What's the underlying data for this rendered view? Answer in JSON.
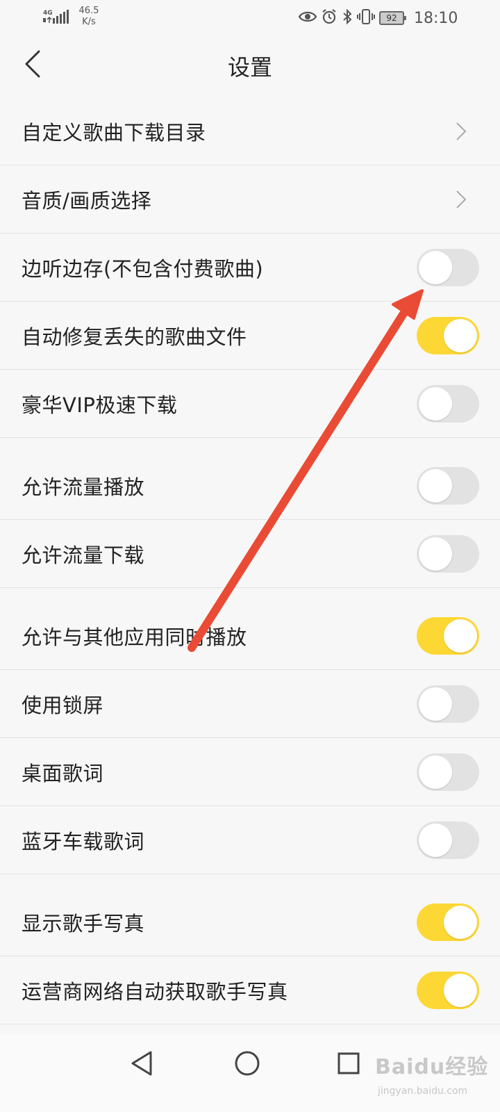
{
  "status_bar": {
    "network": "4G",
    "speed_value": "46.5",
    "speed_unit": "K/s",
    "battery": "92",
    "time": "18:10"
  },
  "header": {
    "title": "设置"
  },
  "settings": [
    {
      "label": "自定义歌曲下载目录",
      "control": "chevron"
    },
    {
      "label": "音质/画质选择",
      "control": "chevron"
    },
    {
      "label": "边听边存(不包含付费歌曲)",
      "control": "toggle",
      "on": false
    },
    {
      "label": "自动修复丢失的歌曲文件",
      "control": "toggle",
      "on": true
    },
    {
      "label": "豪华VIP极速下载",
      "control": "toggle",
      "on": false
    },
    {
      "label": "允许流量播放",
      "control": "toggle",
      "on": false
    },
    {
      "label": "允许流量下载",
      "control": "toggle",
      "on": false
    },
    {
      "label": "允许与其他应用同时播放",
      "control": "toggle",
      "on": true
    },
    {
      "label": "使用锁屏",
      "control": "toggle",
      "on": false
    },
    {
      "label": "桌面歌词",
      "control": "toggle",
      "on": false
    },
    {
      "label": "蓝牙车载歌词",
      "control": "toggle",
      "on": false
    },
    {
      "label": "显示歌手写真",
      "control": "toggle",
      "on": true
    },
    {
      "label": "运营商网络自动获取歌手写真",
      "control": "toggle",
      "on": true
    }
  ],
  "colors": {
    "toggle_on": "#fdd835",
    "toggle_off": "#e2e2e2",
    "annotation_arrow": "#ea4b35"
  },
  "watermark": {
    "main": "Baidu经验",
    "sub": "jingyan.baidu.com"
  }
}
